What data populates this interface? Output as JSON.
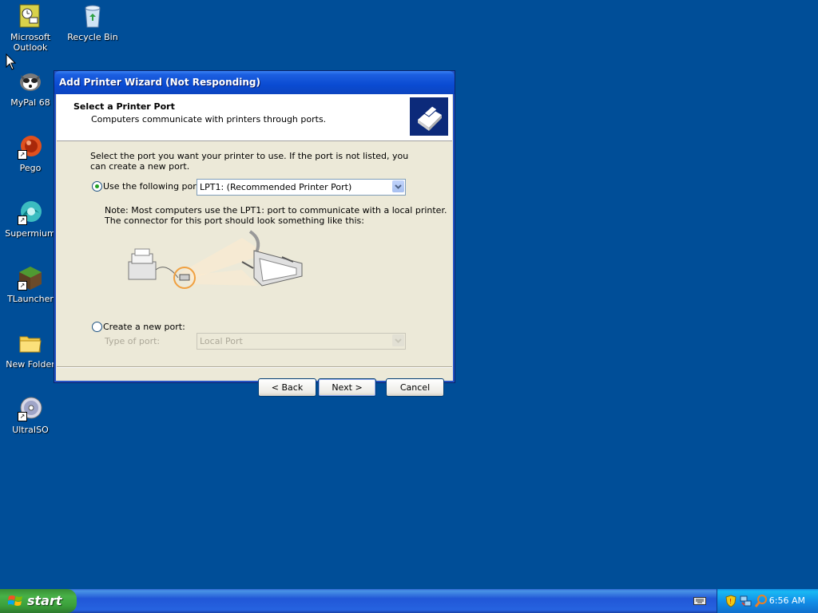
{
  "desktop": {
    "icons": [
      {
        "label": "Microsoft Outlook",
        "icon": "outlook-icon"
      },
      {
        "label": "Recycle Bin",
        "icon": "recycle-bin-icon"
      },
      {
        "label": "MyPal 68",
        "icon": "mypal-icon"
      },
      {
        "label": "Pego",
        "icon": "pego-icon"
      },
      {
        "label": "Supermium",
        "icon": "supermium-icon"
      },
      {
        "label": "TLauncher",
        "icon": "tlauncher-icon"
      },
      {
        "label": "New Folder",
        "icon": "folder-icon"
      },
      {
        "label": "UltraISO",
        "icon": "ultraiso-icon"
      }
    ]
  },
  "window": {
    "title": "Add Printer Wizard (Not Responding)",
    "header_title": "Select a Printer Port",
    "header_subtitle": "Computers communicate with printers through ports.",
    "instruction": "Select the port you want your printer to use.  If the port is not listed, you can create a new port.",
    "use_port_label": "Use the following port:",
    "port_value": "LPT1: (Recommended Printer Port)",
    "note_line1": "Note: Most computers use the LPT1: port to communicate with a local printer.",
    "note_line2": "The connector for this port should look something like this:",
    "create_port_label": "Create a new port:",
    "type_of_port_label": "Type of port:",
    "type_of_port_value": "Local Port",
    "buttons": {
      "back": "< Back",
      "next": "Next >",
      "cancel": "Cancel"
    }
  },
  "taskbar": {
    "start_label": "start",
    "clock": "6:56 AM"
  },
  "colors": {
    "desktop": "#004e98",
    "titlebar": "#0a4bd2",
    "start_button": "#3ba03b",
    "tray": "#1290e9"
  }
}
